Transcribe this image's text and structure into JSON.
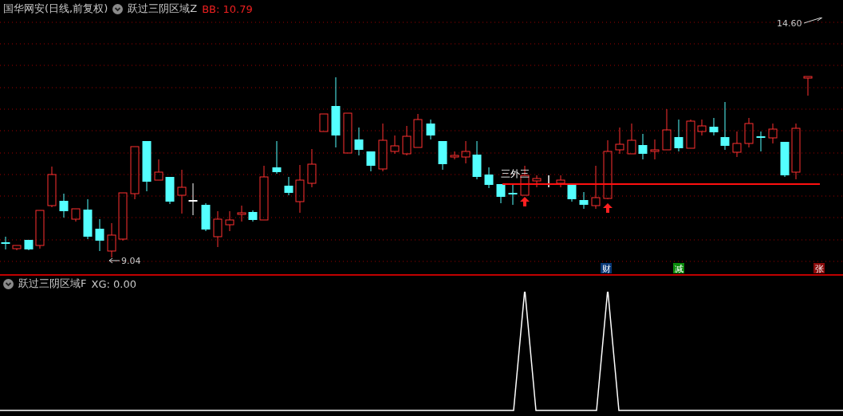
{
  "main_panel": {
    "title": "国华网安(日线,前复权)",
    "indicator": "跃过三阴区域Z",
    "reading": "BB: 10.79",
    "pattern_label": "三外三",
    "high_label": "14.60",
    "low_label": "9.04",
    "markers": [
      {
        "text": "财",
        "color": "#0a3a78"
      },
      {
        "text": "减",
        "color": "#0a8a0a"
      },
      {
        "text": "张",
        "color": "#8a0a0a"
      }
    ]
  },
  "sub_panel": {
    "indicator": "跃过三阴区域F",
    "reading": "XG: 0.00"
  }
}
